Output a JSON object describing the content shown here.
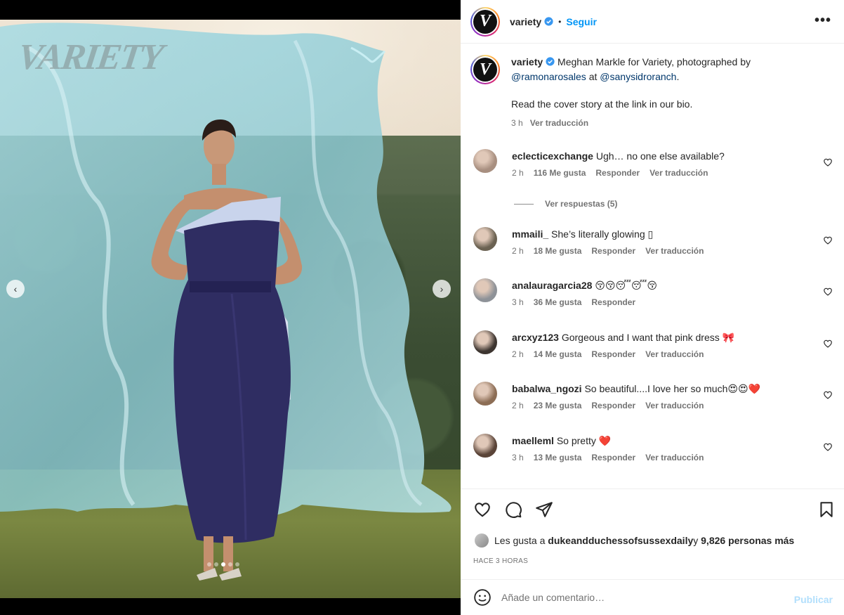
{
  "post": {
    "username": "variety",
    "dot": "•",
    "follow_label": "Seguir",
    "more_label": "•••",
    "logo_letter": "V"
  },
  "media": {
    "watermark": "VARIETY",
    "prev_label": "‹",
    "next_label": "›",
    "slide_count": 5,
    "active_slide": 2
  },
  "caption": {
    "username": "variety",
    "text_before": " Meghan Markle for Variety, photographed by",
    "mention_1": "@ramonarosales",
    "middle": " at ",
    "mention_2": "@sanysidroranch",
    "end": ".",
    "line2": "Read the cover story at the link in our bio.",
    "time": "3 h",
    "translate": "Ver traducción"
  },
  "comments": [
    {
      "user": "eclecticexchange",
      "text": " Ugh… no one else available?",
      "time": "2 h",
      "likes": "116 Me gusta",
      "reply": "Responder",
      "translate": "Ver traducción",
      "avatar_color": "#a88f80"
    },
    {
      "user": "mmaili_",
      "text": " She’s literally glowing ▯",
      "time": "2 h",
      "likes": "18 Me gusta",
      "reply": "Responder",
      "translate": "Ver traducción",
      "avatar_color": "#6b6252"
    },
    {
      "user": "analauragarcia28",
      "text": " 😚😚😴😴😚",
      "time": "3 h",
      "likes": "36 Me gusta",
      "reply": "Responder",
      "translate": "",
      "avatar_color": "#8e9298"
    },
    {
      "user": "arcxyz123",
      "text": " Gorgeous and I want that pink dress 🎀",
      "time": "2 h",
      "likes": "14 Me gusta",
      "reply": "Responder",
      "translate": "Ver traducción",
      "avatar_color": "#3d3530"
    },
    {
      "user": "babalwa_ngozi",
      "text": " So beautiful....I love her so much😍😍❤️",
      "time": "2 h",
      "likes": "23 Me gusta",
      "reply": "Responder",
      "translate": "Ver traducción",
      "avatar_color": "#8c6d55"
    },
    {
      "user": "maelleml",
      "text": " So pretty ❤️",
      "time": "3 h",
      "likes": "13 Me gusta",
      "reply": "Responder",
      "translate": "Ver traducción",
      "avatar_color": "#5a4438"
    }
  ],
  "replies_label": "Ver respuestas (5)",
  "likes": {
    "prefix": "Les gusta a ",
    "user": "dukeandduchessofsussexdaily",
    "middle": " y ",
    "count": "9,826 personas más"
  },
  "timestamp": "HACE 3 HORAS",
  "add_comment": {
    "placeholder": "Añade un comentario…",
    "publish": "Publicar"
  },
  "colors": {
    "accent": "#0095f6",
    "verified": "#3897f0",
    "mention": "#00376b",
    "muted": "#737373",
    "publish_disabled": "#b2dffc"
  }
}
